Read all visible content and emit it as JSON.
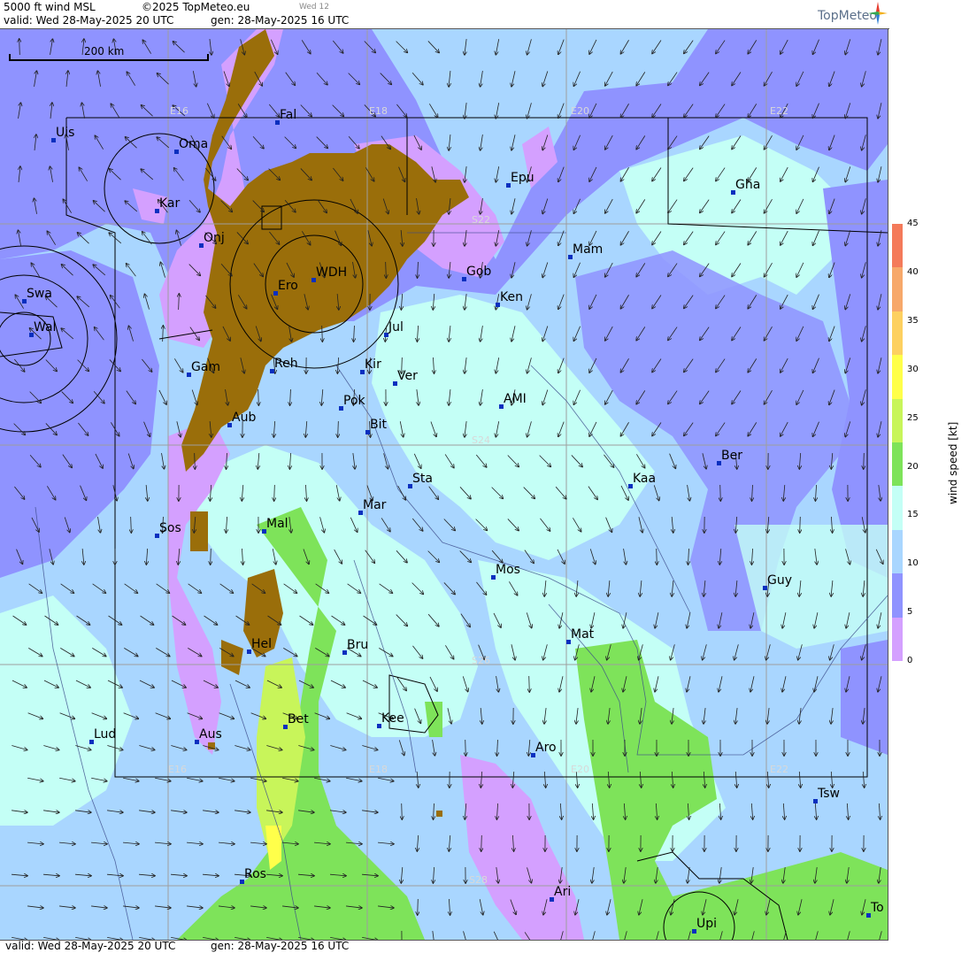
{
  "header": {
    "product": "5000 ft wind MSL",
    "copyright": "©2025 TopMeteo.eu",
    "step": "Wed 12",
    "valid": "valid:  Wed  28-May-2025  20 UTC",
    "generated": "gen: 28-May-2025 16 UTC",
    "brand": "TopMeteo"
  },
  "footer": {
    "valid": "valid:  Wed  28-May-2025  20 UTC",
    "generated": "gen: 28-May-2025 16 UTC"
  },
  "scale": {
    "label": "200 km"
  },
  "legend": {
    "title": "wind speed [kt]",
    "ticks": [
      "45",
      "40",
      "35",
      "30",
      "25",
      "20",
      "15",
      "10",
      "5",
      "0"
    ],
    "colors": [
      "#f47a5a",
      "#f7a86a",
      "#fdd060",
      "#ffff4a",
      "#c8f55a",
      "#7ee35a",
      "#c4fff6",
      "#a9d6ff",
      "#8f93ff",
      "#d4a0ff"
    ]
  },
  "grid_labels": [
    "E16",
    "E18",
    "E20",
    "E22",
    "S22",
    "S24",
    "S26",
    "S28",
    "E16",
    "E18",
    "E20",
    "E22"
  ],
  "cities": [
    {
      "name": "Uis"
    },
    {
      "name": "Oma"
    },
    {
      "name": "Fal"
    },
    {
      "name": "Kar"
    },
    {
      "name": "Onj"
    },
    {
      "name": "Epu"
    },
    {
      "name": "Gha"
    },
    {
      "name": "Swa"
    },
    {
      "name": "Wal"
    },
    {
      "name": "Ero"
    },
    {
      "name": "WDH"
    },
    {
      "name": "Gob"
    },
    {
      "name": "Mam"
    },
    {
      "name": "Ken"
    },
    {
      "name": "Jul"
    },
    {
      "name": "Kir"
    },
    {
      "name": "Gam"
    },
    {
      "name": "Reh"
    },
    {
      "name": "Ver"
    },
    {
      "name": "Pok"
    },
    {
      "name": "AMI"
    },
    {
      "name": "Aub"
    },
    {
      "name": "Bit"
    },
    {
      "name": "Ber"
    },
    {
      "name": "Sta"
    },
    {
      "name": "Kaa"
    },
    {
      "name": "Mar"
    },
    {
      "name": "Sos"
    },
    {
      "name": "Mal"
    },
    {
      "name": "Mos"
    },
    {
      "name": "Guy"
    },
    {
      "name": "Mat"
    },
    {
      "name": "Hel"
    },
    {
      "name": "Bru"
    },
    {
      "name": "Bet"
    },
    {
      "name": "Kee"
    },
    {
      "name": "Lud"
    },
    {
      "name": "Aus"
    },
    {
      "name": "Aro"
    },
    {
      "name": "Tsw"
    },
    {
      "name": "Ros"
    },
    {
      "name": "Ari"
    },
    {
      "name": "Upi"
    },
    {
      "name": "To"
    }
  ]
}
